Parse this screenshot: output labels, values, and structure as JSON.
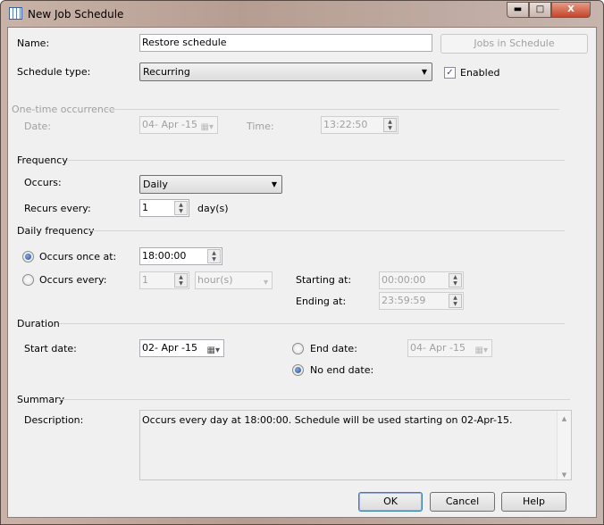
{
  "window": {
    "title": "New Job Schedule",
    "icon": "calendar-grid-icon",
    "controls": [
      "minimize",
      "maximize",
      "close"
    ]
  },
  "name": {
    "label": "Name:",
    "value": "Restore schedule",
    "jobs_button": "Jobs in Schedule"
  },
  "schedule_type": {
    "label": "Schedule type:",
    "value": "Recurring",
    "enabled_label": "Enabled",
    "enabled": true
  },
  "one_time": {
    "header": "One-time occurrence",
    "date_label": "Date:",
    "date": "04- Apr -15",
    "time_label": "Time:",
    "time": "13:22:50"
  },
  "frequency": {
    "header": "Frequency",
    "occurs_label": "Occurs:",
    "occurs": "Daily",
    "recurs_label": "Recurs every:",
    "recurs": "1",
    "recurs_unit": "day(s)"
  },
  "daily": {
    "header": "Daily frequency",
    "once_label": "Occurs once at:",
    "once_time": "18:00:00",
    "every_label": "Occurs every:",
    "every_value": "1",
    "every_unit": "hour(s)",
    "start_label": "Starting at:",
    "start": "00:00:00",
    "end_label": "Ending at:",
    "end": "23:59:59",
    "selected": "once"
  },
  "duration": {
    "header": "Duration",
    "start_label": "Start date:",
    "start": "02- Apr -15",
    "end_label": "End date:",
    "end": "04- Apr -15",
    "no_end_label": "No end date:",
    "selected": "no_end"
  },
  "summary": {
    "header": "Summary",
    "desc_label": "Description:",
    "desc": "Occurs every day at 18:00:00. Schedule will be used starting on 02-Apr-15."
  },
  "buttons": {
    "ok": "OK",
    "cancel": "Cancel",
    "help": "Help"
  }
}
